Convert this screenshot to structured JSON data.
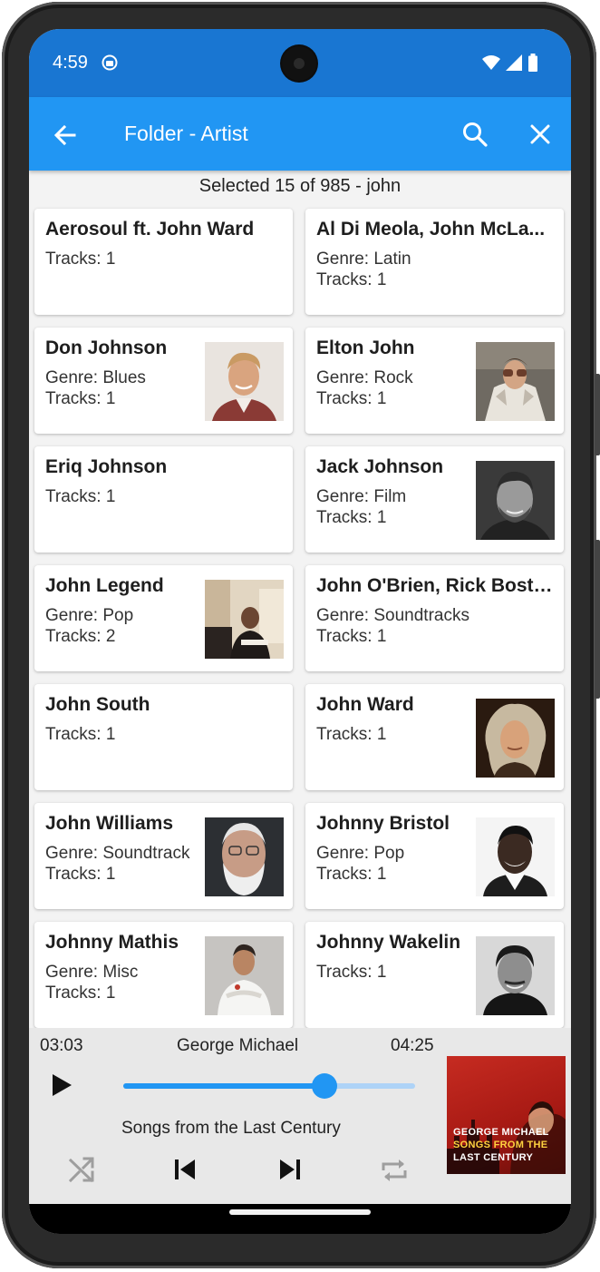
{
  "status_bar": {
    "time": "4:59"
  },
  "app_bar": {
    "title": "Folder - Artist"
  },
  "selection_info": "Selected 15 of 985  - john",
  "artists": [
    {
      "name": "Aerosoul ft. John Ward",
      "line1": "Tracks: 1",
      "line2": ""
    },
    {
      "name": "Al Di Meola, John McLa...",
      "line1": "Genre: Latin",
      "line2": "Tracks: 1"
    },
    {
      "name": "Don Johnson",
      "line1": "Genre: Blues",
      "line2": "Tracks: 1"
    },
    {
      "name": "Elton John",
      "line1": "Genre: Rock",
      "line2": "Tracks: 1"
    },
    {
      "name": "Eriq Johnson",
      "line1": "Tracks: 1",
      "line2": ""
    },
    {
      "name": "Jack Johnson",
      "line1": "Genre: Film",
      "line2": "Tracks: 1"
    },
    {
      "name": "John Legend",
      "line1": "Genre: Pop",
      "line2": "Tracks: 2"
    },
    {
      "name": "John O'Brien, Rick Boston",
      "line1": "Genre: Soundtracks",
      "line2": "Tracks: 1"
    },
    {
      "name": "John South",
      "line1": "Tracks: 1",
      "line2": ""
    },
    {
      "name": "John Ward",
      "line1": "Tracks: 1",
      "line2": ""
    },
    {
      "name": "John Williams",
      "line1": "Genre: Soundtrack",
      "line2": "Tracks: 1"
    },
    {
      "name": "Johnny Bristol",
      "line1": "Genre: Pop",
      "line2": "Tracks: 1"
    },
    {
      "name": "Johnny Mathis",
      "line1": "Genre: Misc",
      "line2": "Tracks: 1"
    },
    {
      "name": "Johnny Wakelin",
      "line1": "Tracks: 1",
      "line2": ""
    }
  ],
  "player": {
    "elapsed": "03:03",
    "artist": "George Michael",
    "total": "04:25",
    "album": "Songs from the Last Century",
    "progress_fraction": 0.69,
    "cover_line1": "GEORGE MICHAEL",
    "cover_line2": "SONGS FROM THE",
    "cover_line3": "LAST CENTURY"
  },
  "colors": {
    "status_bar": "#1976d2",
    "app_bar": "#2196f3",
    "accent": "#2196f3",
    "player_bg": "#e8e8e8"
  }
}
